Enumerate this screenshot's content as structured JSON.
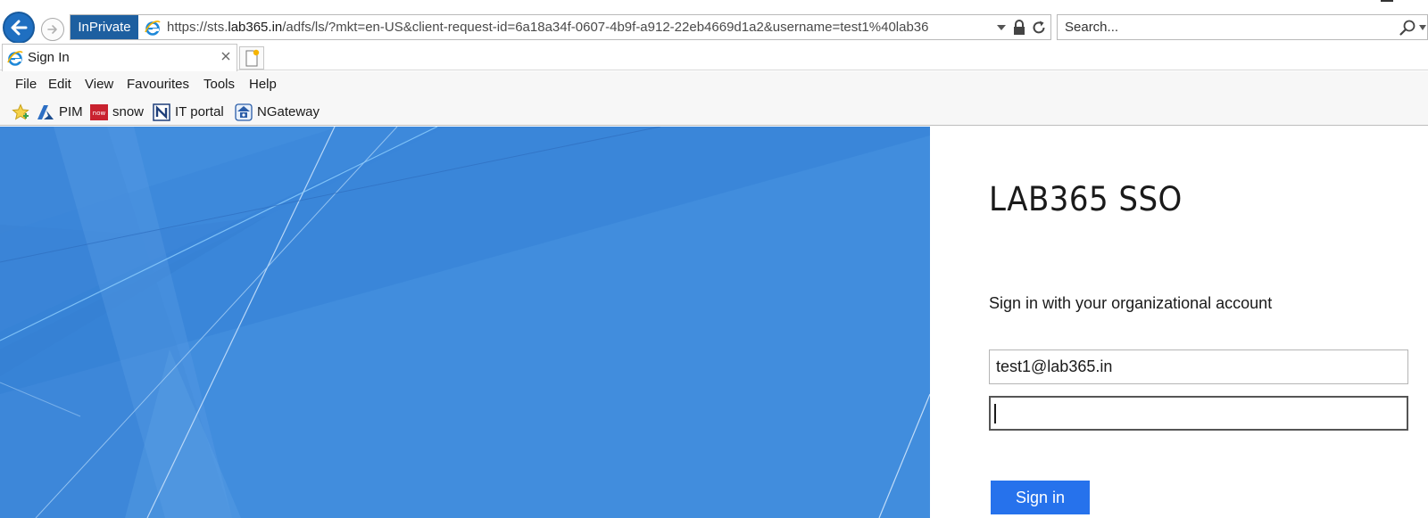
{
  "browser": {
    "inprivate_label": "InPrivate",
    "url_scheme": "https://sts.",
    "url_host": "lab365.in",
    "url_rest": "/adfs/ls/?mkt=en-US&client-request-id=6a18a34f-0607-4b9f-a912-22eb4669d1a2&username=test1%40lab36",
    "search_placeholder": "Search...",
    "accent_color": "#1d5fa0"
  },
  "tabs": [
    {
      "label": "Sign In",
      "icon": "ie-icon"
    }
  ],
  "menu": [
    "File",
    "Edit",
    "View",
    "Favourites",
    "Tools",
    "Help"
  ],
  "favourites": [
    {
      "label": "PIM",
      "icon": "azure-icon"
    },
    {
      "label": "snow",
      "icon": "now-icon"
    },
    {
      "label": "IT portal",
      "icon": "portal-icon"
    },
    {
      "label": "NGateway",
      "icon": "gateway-icon"
    }
  ],
  "login": {
    "org_name": "LAB365 SSO",
    "instruction": "Sign in with your organizational account",
    "username_value": "test1@lab365.in",
    "password_value": "",
    "signin_label": "Sign in",
    "button_color": "#2672ec",
    "illustration_color": "#418ddd"
  }
}
